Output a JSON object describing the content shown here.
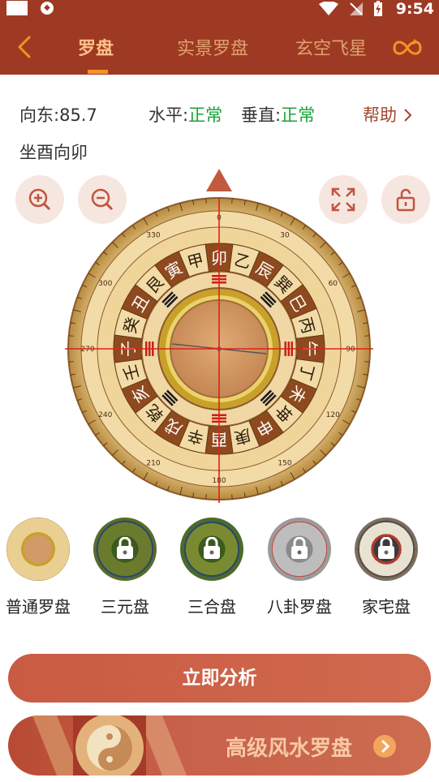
{
  "status_bar": {
    "time": "9:54"
  },
  "nav": {
    "tabs": [
      {
        "label": "罗盘",
        "active": true
      },
      {
        "label": "实景罗盘",
        "active": false
      },
      {
        "label": "玄空飞星",
        "active": false
      }
    ]
  },
  "readout": {
    "direction_label": "向东:",
    "direction_value": "85.7",
    "level_label": "水平:",
    "level_value": "正常",
    "vertical_label": "垂直:",
    "vertical_value": "正常",
    "help_label": "帮助",
    "sitting_text": "坐酉向卯"
  },
  "compass": {
    "mountains": [
      "卯",
      "乙",
      "辰",
      "巽",
      "巳",
      "丙",
      "午",
      "丁",
      "未",
      "坤",
      "申",
      "庚",
      "酉",
      "辛",
      "戌",
      "乾",
      "亥",
      "壬",
      "子",
      "癸",
      "丑",
      "艮",
      "寅",
      "甲"
    ],
    "degree_labels": [
      "0",
      "30",
      "60",
      "90",
      "120",
      "150",
      "180",
      "210",
      "240",
      "270",
      "300",
      "330"
    ]
  },
  "compass_types": [
    {
      "label": "普通罗盘",
      "locked": false,
      "color": "#d9b46a"
    },
    {
      "label": "三元盘",
      "locked": true,
      "color": "#5a6b2a"
    },
    {
      "label": "三合盘",
      "locked": true,
      "color": "#4b6a2c"
    },
    {
      "label": "八卦罗盘",
      "locked": true,
      "color": "#9a9a9a"
    },
    {
      "label": "家宅盘",
      "locked": true,
      "color": "#7a6f60"
    }
  ],
  "actions": {
    "analyze_label": "立即分析"
  },
  "promo": {
    "title": "高级风水罗盘"
  },
  "colors": {
    "brand": "#9e3a24",
    "accent": "#f7931e",
    "ok_green": "#19a13a",
    "button": "#cc644b"
  }
}
